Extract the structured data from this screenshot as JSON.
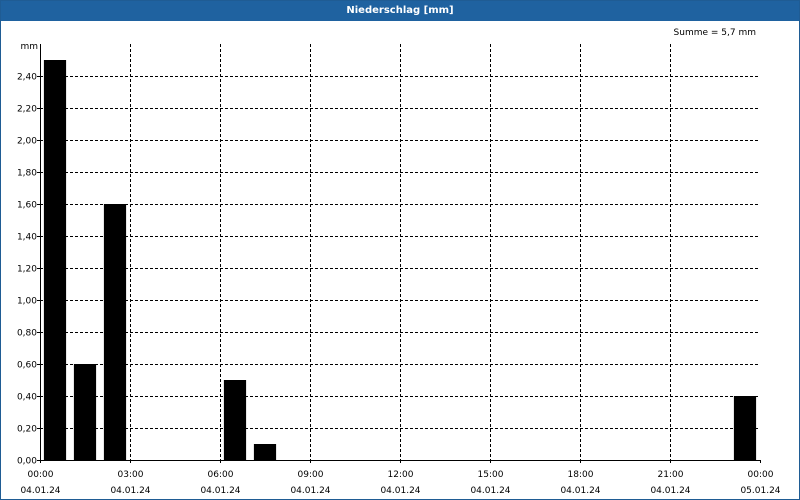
{
  "title": "Niederschlag [mm]",
  "summary": "Summe = 5,7 mm",
  "colors": {
    "titlebar": "#1f62a0",
    "bar": "#000000",
    "grid": "#000000"
  },
  "chart_data": {
    "type": "bar",
    "title": "Niederschlag [mm]",
    "ylabel": "mm",
    "xlabel": "",
    "ylim": [
      0,
      2.6
    ],
    "y_ticks": [
      "0,00",
      "0,20",
      "0,40",
      "0,60",
      "0,80",
      "1,00",
      "1,20",
      "1,40",
      "1,60",
      "1,80",
      "2,00",
      "2,20",
      "2,40"
    ],
    "x_range_hours": [
      0,
      24
    ],
    "x_ticks": [
      {
        "hour": 0,
        "time": "00:00",
        "date": "04.01.24"
      },
      {
        "hour": 3,
        "time": "03:00",
        "date": "04.01.24"
      },
      {
        "hour": 6,
        "time": "06:00",
        "date": "04.01.24"
      },
      {
        "hour": 9,
        "time": "09:00",
        "date": "04.01.24"
      },
      {
        "hour": 12,
        "time": "12:00",
        "date": "04.01.24"
      },
      {
        "hour": 15,
        "time": "15:00",
        "date": "04.01.24"
      },
      {
        "hour": 18,
        "time": "18:00",
        "date": "04.01.24"
      },
      {
        "hour": 21,
        "time": "21:00",
        "date": "04.01.24"
      },
      {
        "hour": 24,
        "time": "00:00",
        "date": "05.01.24"
      }
    ],
    "bars": [
      {
        "start": 0,
        "end": 1,
        "value": 2.5
      },
      {
        "start": 1,
        "end": 2,
        "value": 0.6
      },
      {
        "start": 2,
        "end": 3,
        "value": 1.6
      },
      {
        "start": 6,
        "end": 7,
        "value": 0.5
      },
      {
        "start": 7,
        "end": 8,
        "value": 0.1
      },
      {
        "start": 23,
        "end": 24,
        "value": 0.4
      }
    ],
    "grid": true
  }
}
